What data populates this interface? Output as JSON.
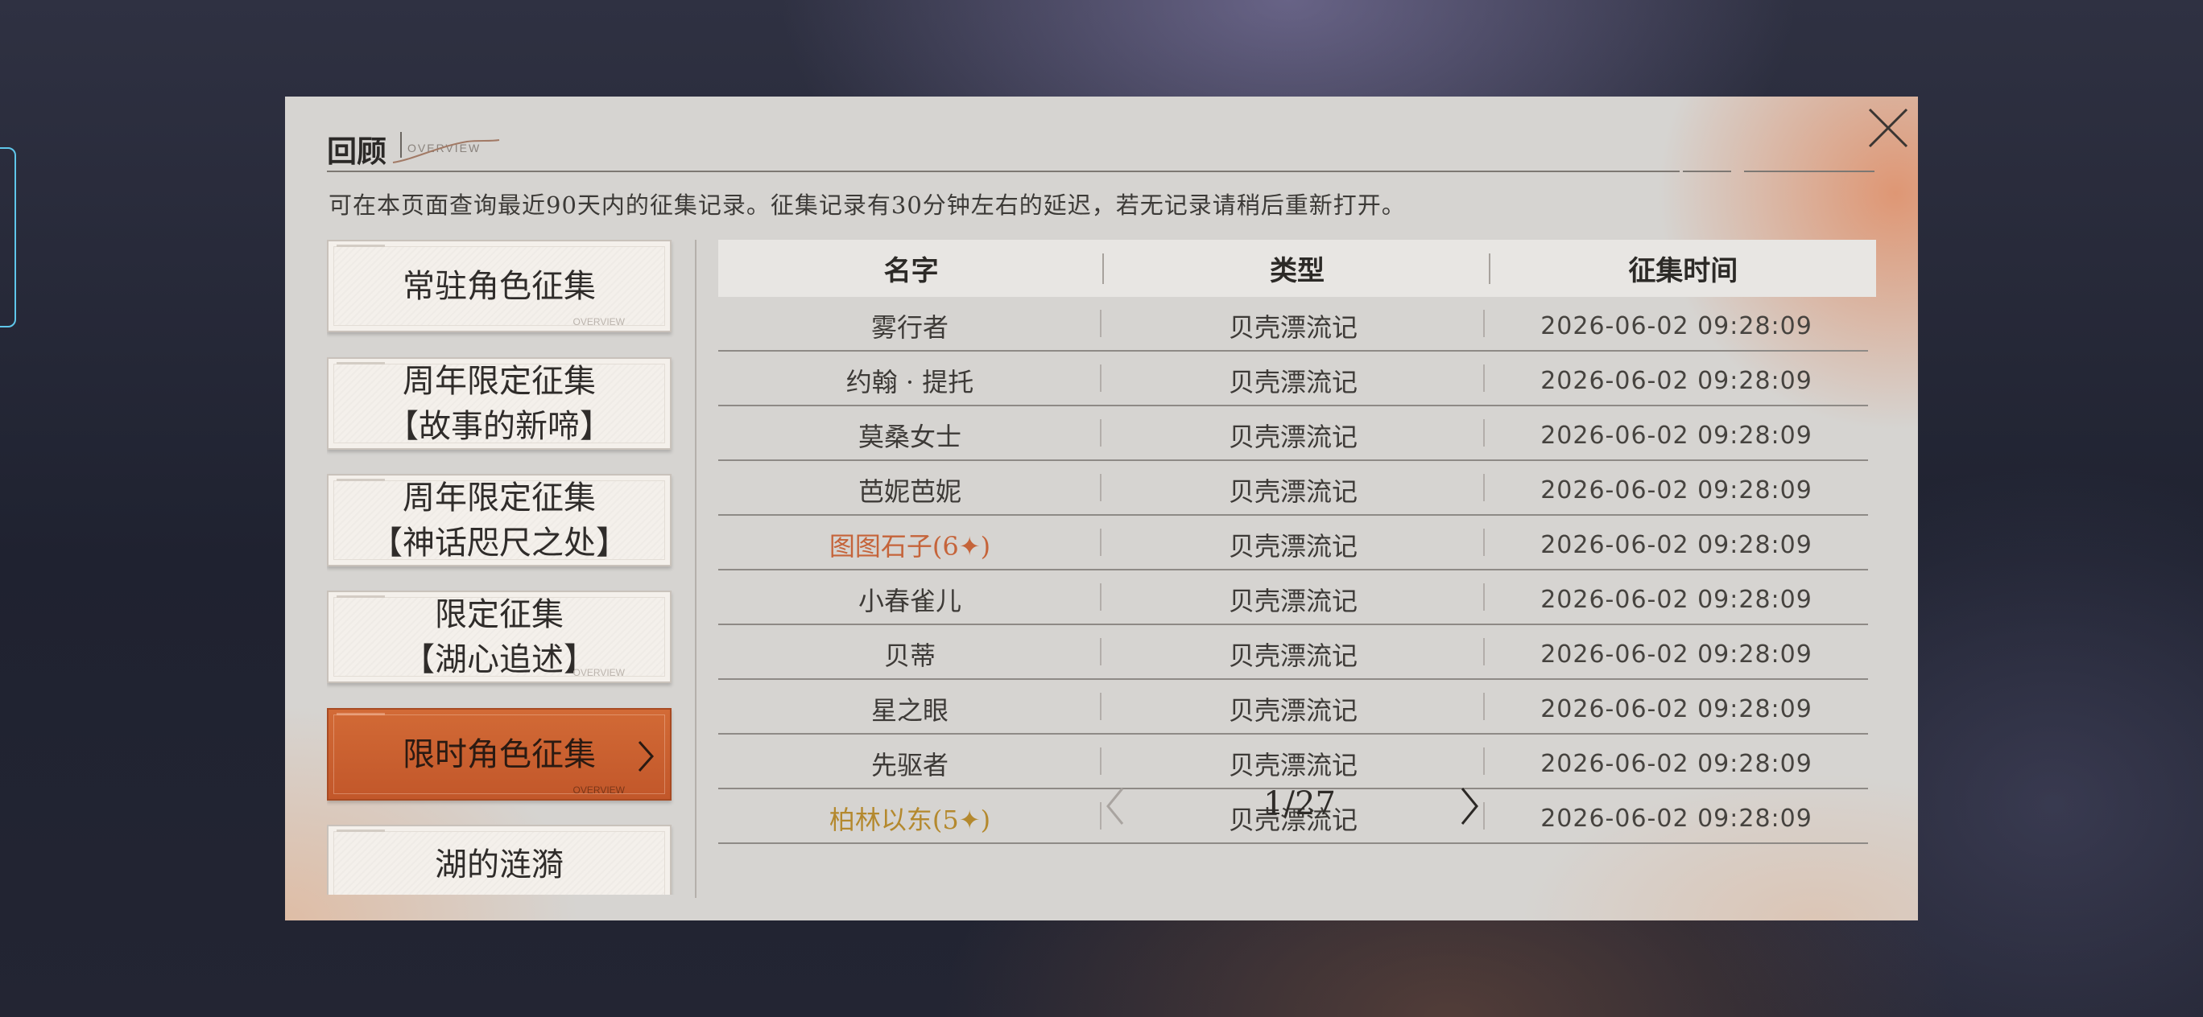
{
  "panel": {
    "title": "回顾",
    "title_sub": "OVERVIEW",
    "notice": "可在本页面查询最近90天内的征集记录。征集记录有30分钟左右的延迟，若无记录请稍后重新打开。",
    "close_icon": "close-icon"
  },
  "sidebar": {
    "items": [
      {
        "line1": "常驻角色征集",
        "line2": "",
        "active": false
      },
      {
        "line1": "周年限定征集",
        "line2": "【故事的新啼】",
        "active": false
      },
      {
        "line1": "周年限定征集",
        "line2": "【神话咫尺之处】",
        "active": false
      },
      {
        "line1": "限定征集",
        "line2": "【湖心追述】",
        "active": false
      },
      {
        "line1": "限时角色征集",
        "line2": "",
        "active": true
      },
      {
        "line1": "湖的涟漪",
        "line2": "",
        "active": false
      }
    ],
    "deco_text": "OVERVIEW"
  },
  "table": {
    "headers": [
      "名字",
      "类型",
      "征集时间"
    ],
    "rows": [
      {
        "name": "雾行者",
        "type": "贝壳漂流记",
        "time": "2026-06-02 09:28:09",
        "rarity": ""
      },
      {
        "name": "约翰 · 提托",
        "type": "贝壳漂流记",
        "time": "2026-06-02 09:28:09",
        "rarity": ""
      },
      {
        "name": "莫桑女士",
        "type": "贝壳漂流记",
        "time": "2026-06-02 09:28:09",
        "rarity": ""
      },
      {
        "name": "芭妮芭妮",
        "type": "贝壳漂流记",
        "time": "2026-06-02 09:28:09",
        "rarity": ""
      },
      {
        "name": "图图石子(6✦)",
        "type": "贝壳漂流记",
        "time": "2026-06-02 09:28:09",
        "rarity": "six"
      },
      {
        "name": "小春雀儿",
        "type": "贝壳漂流记",
        "time": "2026-06-02 09:28:09",
        "rarity": ""
      },
      {
        "name": "贝蒂",
        "type": "贝壳漂流记",
        "time": "2026-06-02 09:28:09",
        "rarity": ""
      },
      {
        "name": "星之眼",
        "type": "贝壳漂流记",
        "time": "2026-06-02 09:28:09",
        "rarity": ""
      },
      {
        "name": "先驱者",
        "type": "贝壳漂流记",
        "time": "2026-06-02 09:28:09",
        "rarity": ""
      },
      {
        "name": "柏林以东(5✦)",
        "type": "贝壳漂流记",
        "time": "2026-06-02 09:28:09",
        "rarity": "five"
      }
    ]
  },
  "pager": {
    "page_text": "1/27",
    "prev_icon": "chevron-left-icon",
    "next_icon": "chevron-right-icon"
  },
  "colors": {
    "accent": "#c95f2f",
    "six_star": "#c5643a",
    "five_star": "#b4892e",
    "panel_bg": "#d6d4d1"
  }
}
